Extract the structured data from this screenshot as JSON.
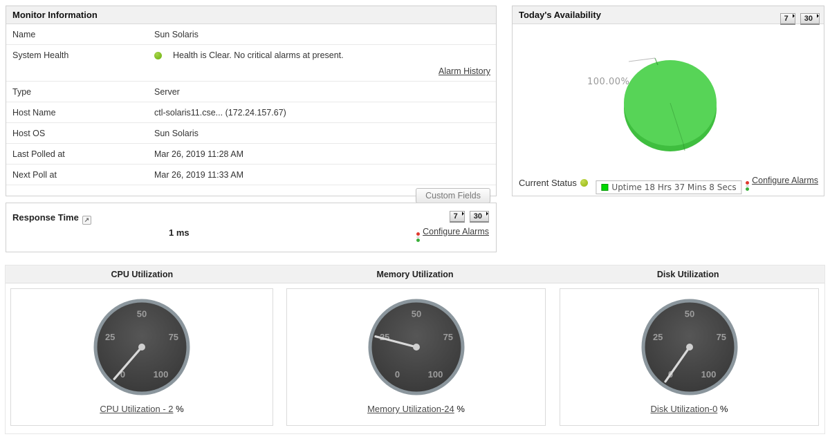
{
  "colors": {
    "health_green": "#7cbb1f",
    "status_green": "#a3c021",
    "legend_green": "#00d800",
    "pie_top_green": "#57d457",
    "pie_rim_green": "#3fbe3f",
    "gauge_body": "#3d3d3d",
    "gauge_rim": "#8b969d",
    "needle": "#d9d9d9"
  },
  "monitor_info": {
    "title": "Monitor Information",
    "rows": [
      {
        "label": "Name",
        "value": "Sun Solaris"
      },
      {
        "label": "System Health",
        "value": "Health is Clear. No critical alarms at present.",
        "has_dot": true,
        "link": "Alarm History"
      },
      {
        "label": "Type",
        "value": "Server"
      },
      {
        "label": "Host Name",
        "value": "ctl-solaris11.cse... (172.24.157.67)"
      },
      {
        "label": "Host OS",
        "value": "Sun Solaris"
      },
      {
        "label": "Last Polled at",
        "value": "Mar 26, 2019 11:28 AM"
      },
      {
        "label": "Next Poll at",
        "value": "Mar 26, 2019 11:33 AM"
      }
    ],
    "custom_fields_button": "Custom Fields"
  },
  "availability": {
    "title": "Today's Availability",
    "range_buttons": [
      "7",
      "30"
    ],
    "pie_label": "100.00%",
    "legend": "Uptime 18 Hrs 37 Mins 8 Secs",
    "current_status_label": "Current Status",
    "configure_alarms": "Configure Alarms"
  },
  "response_time": {
    "title": "Response Time",
    "value": "1 ms",
    "range_buttons": [
      "7",
      "30"
    ],
    "configure_alarms": "Configure Alarms"
  },
  "utilization_headers": [
    "CPU Utilization",
    "Memory Utilization",
    "Disk Utilization"
  ],
  "chart_data": [
    {
      "type": "pie",
      "title": "Today's Availability",
      "slices": [
        {
          "label": "Uptime 18 Hrs 37 Mins 8 Secs",
          "value": 100.0,
          "color": "#57d457"
        }
      ],
      "data_label": "100.00%",
      "legend_position": "bottom"
    },
    {
      "type": "gauge",
      "title": "CPU Utilization",
      "value": 2,
      "min": 0,
      "max": 100,
      "ticks": [
        0,
        25,
        50,
        75,
        100
      ],
      "caption": "CPU Utilization - 2",
      "suffix": " %"
    },
    {
      "type": "gauge",
      "title": "Memory Utilization",
      "value": 24,
      "min": 0,
      "max": 100,
      "ticks": [
        0,
        25,
        50,
        75,
        100
      ],
      "caption": "Memory Utilization-24",
      "suffix": " %"
    },
    {
      "type": "gauge",
      "title": "Disk Utilization",
      "value": 0,
      "min": 0,
      "max": 100,
      "ticks": [
        0,
        25,
        50,
        75,
        100
      ],
      "caption": "Disk Utilization-0",
      "suffix": " %"
    }
  ]
}
